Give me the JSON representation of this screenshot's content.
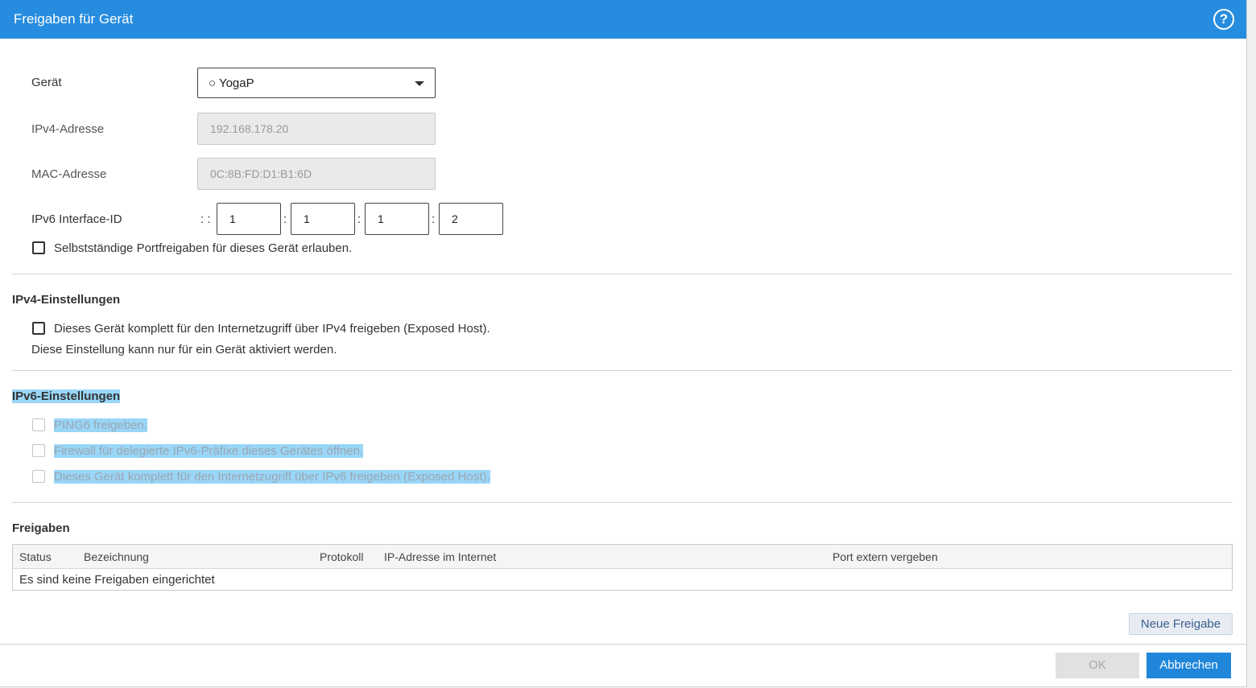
{
  "header": {
    "title": "Freigaben für Gerät",
    "help_icon": "question-circle-icon",
    "help_glyph": "?",
    "color": "#268cdf"
  },
  "device": {
    "label": "Gerät",
    "selected": "○ YogaP",
    "ipv4_label": "IPv4-Adresse",
    "ipv4_value": "192.168.178.20",
    "mac_label": "MAC-Adresse",
    "mac_value": "0C:8B:FD:D1:B1:6D",
    "ipv6_label": "IPv6 Interface-ID",
    "ipv6_prefix": ": :",
    "ipv6_parts": [
      "1",
      "1",
      "1",
      "2"
    ],
    "ipv6_sep": ":",
    "allow_portfwd_label": "Selbstständige Portfreigaben für dieses Gerät erlauben.",
    "allow_portfwd_checked": false
  },
  "ipv4_settings": {
    "heading": "IPv4-Einstellungen",
    "exposed_host_label": "Dieses Gerät komplett für den Internetzugriff über IPv4 freigeben (Exposed Host).",
    "exposed_host_checked": false,
    "note": "Diese Einstellung kann nur für ein Gerät aktiviert werden."
  },
  "ipv6_settings": {
    "heading": "IPv6-Einstellungen",
    "options": [
      {
        "label": "PING6 freigeben.",
        "checked": false,
        "disabled": true
      },
      {
        "label": "Firewall für delegierte IPv6-Präfixe dieses Gerätes öffnen.",
        "checked": false,
        "disabled": true
      },
      {
        "label": "Dieses Gerät komplett für den Internetzugriff über IPv6 freigeben (Exposed Host).",
        "checked": false,
        "disabled": true
      }
    ]
  },
  "freigaben": {
    "heading": "Freigaben",
    "columns": [
      "Status",
      "Bezeichnung",
      "Protokoll",
      "IP-Adresse im Internet",
      "Port extern vergeben"
    ],
    "empty_text": "Es sind keine Freigaben eingerichtet",
    "new_button": "Neue Freigabe"
  },
  "footer": {
    "ok_label": "OK",
    "cancel_label": "Abbrechen",
    "accent": "#1f86da"
  }
}
